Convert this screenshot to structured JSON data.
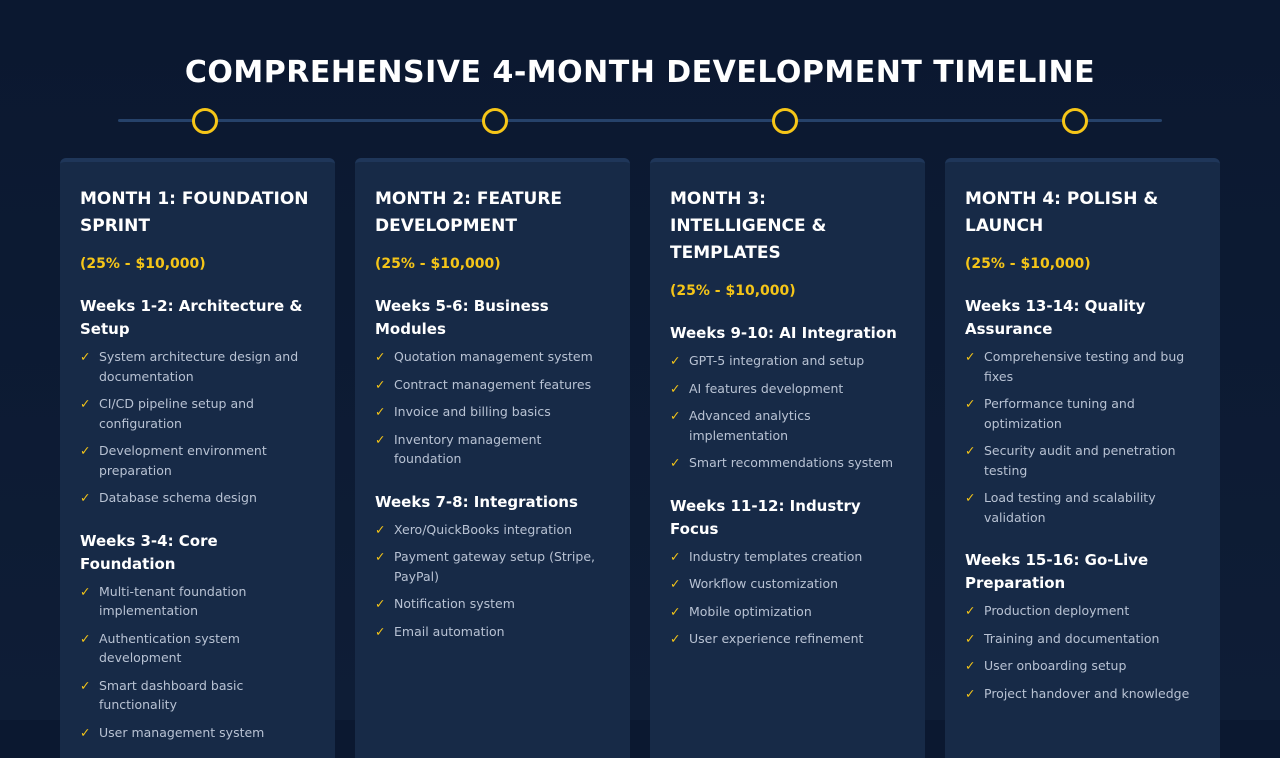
{
  "header": {
    "title": "COMPREHENSIVE 4-MONTH DEVELOPMENT TIMELINE"
  },
  "colors": {
    "background": "#0b1830",
    "card": "#172a47",
    "accent": "#f5c518",
    "timeline": "#26426a",
    "item_text": "#b8c2d3"
  },
  "icons": {
    "check": "✓",
    "timeline_node": "circle-outline"
  },
  "months": [
    {
      "title": "MONTH 1: FOUNDATION\nSPRINT",
      "budget": "(25% - $10,000)",
      "sections": [
        {
          "title": "Weeks 1-2: Architecture &\nSetup",
          "items": [
            "System architecture design and\ndocumentation",
            "CI/CD pipeline setup and\nconfiguration",
            "Development environment\npreparation",
            "Database schema design"
          ]
        },
        {
          "title": "Weeks 3-4: Core Foundation",
          "items": [
            "Multi-tenant foundation\nimplementation",
            "Authentication system\ndevelopment",
            "Smart dashboard basic\nfunctionality",
            "User management system"
          ]
        }
      ]
    },
    {
      "title": "MONTH 2: FEATURE\nDEVELOPMENT",
      "budget": "(25% - $10,000)",
      "sections": [
        {
          "title": "Weeks 5-6: Business Modules",
          "items": [
            "Quotation management system",
            "Contract management features",
            "Invoice and billing basics",
            "Inventory management\nfoundation"
          ]
        },
        {
          "title": "Weeks 7-8: Integrations",
          "items": [
            "Xero/QuickBooks integration",
            "Payment gateway setup (Stripe,\nPayPal)",
            "Notification system",
            "Email automation"
          ]
        }
      ]
    },
    {
      "title": "MONTH 3: INTELLIGENCE &\nTEMPLATES",
      "budget": "(25% - $10,000)",
      "sections": [
        {
          "title": "Weeks 9-10: AI Integration",
          "items": [
            "GPT-5 integration and setup",
            "AI features development",
            "Advanced analytics\nimplementation",
            "Smart recommendations system"
          ]
        },
        {
          "title": "Weeks 11-12: Industry Focus",
          "items": [
            "Industry templates creation",
            "Workflow customization",
            "Mobile optimization",
            "User experience refinement"
          ]
        }
      ]
    },
    {
      "title": "MONTH 4: POLISH &\nLAUNCH",
      "budget": "(25% - $10,000)",
      "sections": [
        {
          "title": "Weeks 13-14: Quality\nAssurance",
          "items": [
            "Comprehensive testing and bug\nfixes",
            "Performance tuning and\noptimization",
            "Security audit and penetration\ntesting",
            "Load testing and scalability\nvalidation"
          ]
        },
        {
          "title": "Weeks 15-16: Go-Live\nPreparation",
          "items": [
            "Production deployment",
            "Training and documentation",
            "User onboarding setup",
            "Project handover and knowledge"
          ]
        }
      ]
    }
  ]
}
